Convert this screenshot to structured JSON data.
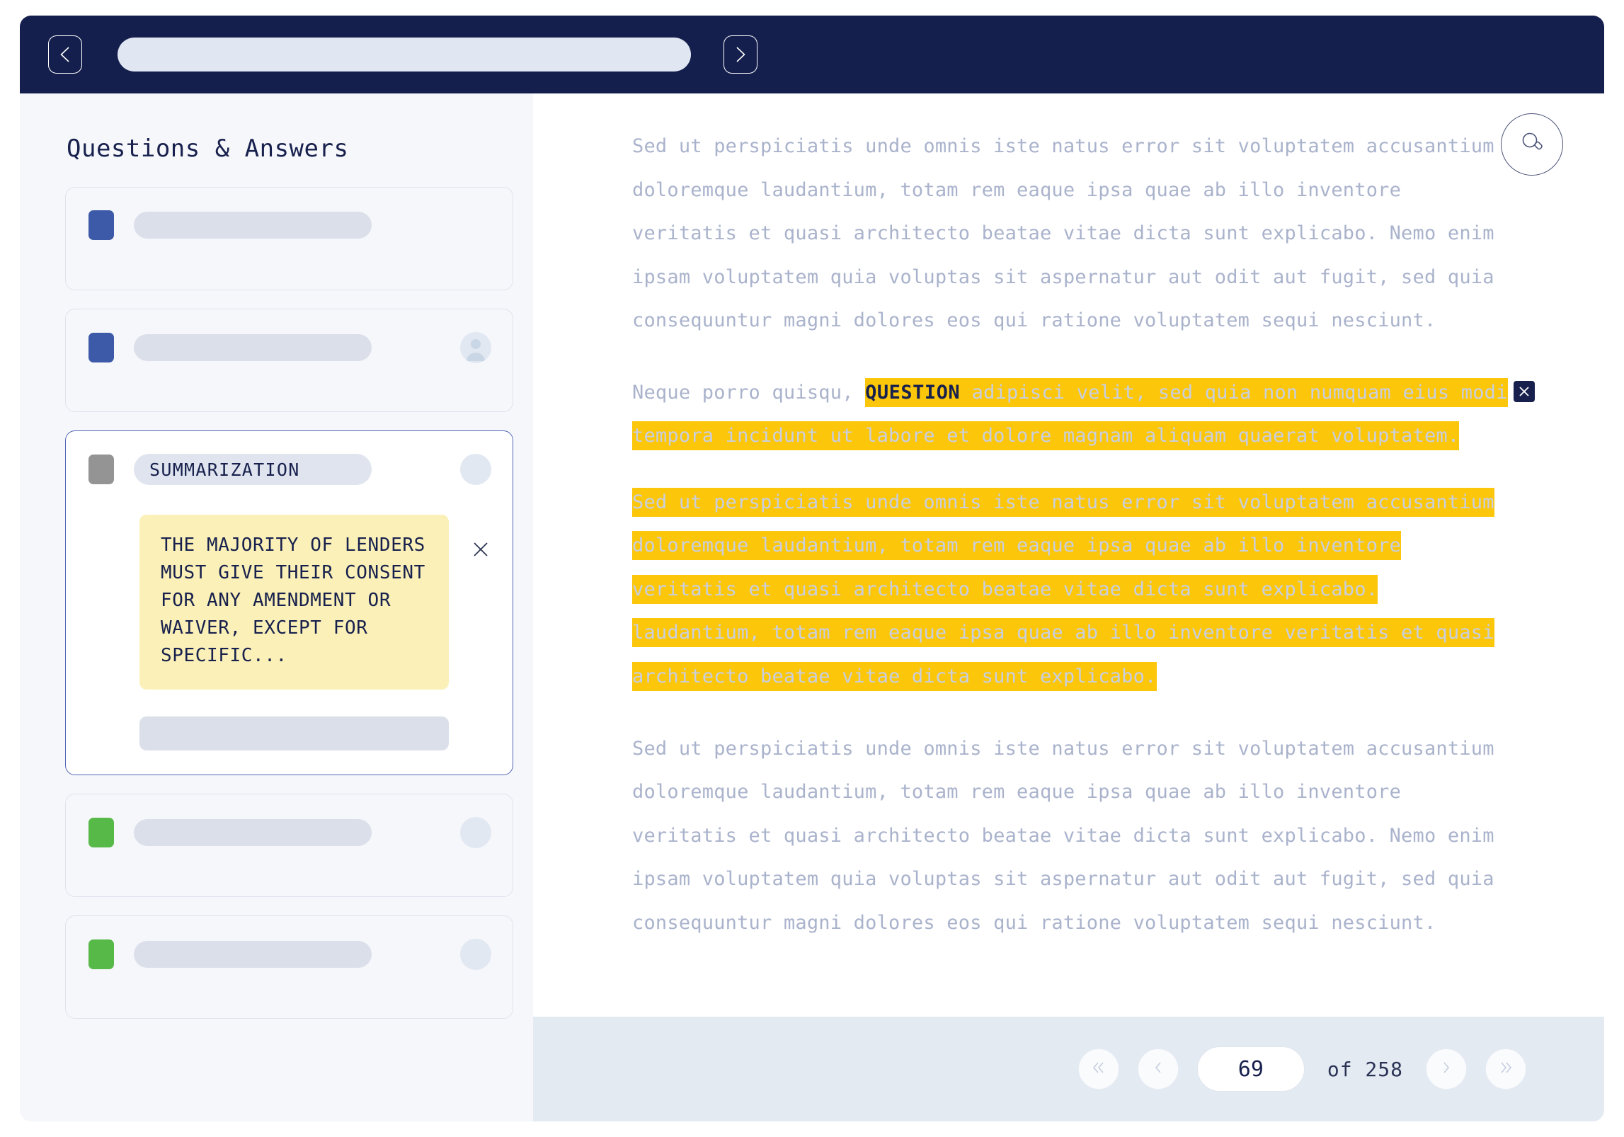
{
  "topbar": {
    "back_icon": "chevron-left-icon",
    "forward_icon": "chevron-right-icon",
    "address_value": "",
    "address_placeholder": ""
  },
  "sidebar": {
    "title": "Questions & Answers",
    "cards": [
      {
        "tag_color": "#3d5aa8",
        "label": "",
        "has_avatar": false,
        "avatar_type": "none",
        "active": false
      },
      {
        "tag_color": "#3d5aa8",
        "label": "",
        "has_avatar": true,
        "avatar_type": "person",
        "active": false
      },
      {
        "tag_color": "#949494",
        "label": "SUMMARIZATION",
        "has_avatar": true,
        "avatar_type": "plain",
        "active": true
      },
      {
        "tag_color": "#57b947",
        "label": "",
        "has_avatar": true,
        "avatar_type": "plain",
        "active": false
      },
      {
        "tag_color": "#57b947",
        "label": "",
        "has_avatar": true,
        "avatar_type": "plain",
        "active": false
      }
    ],
    "note": {
      "text": "THE MAJORITY OF LENDERS MUST GIVE THEIR CONSENT FOR ANY AMENDMENT OR WAIVER, EXCEPT FOR SPECIFIC...",
      "close_icon": "close-icon"
    }
  },
  "content": {
    "search_icon": "search-icon",
    "paragraph_1": "Sed ut perspiciatis unde omnis iste natus error sit voluptatem accusantium doloremque laudantium, totam rem eaque ipsa quae ab illo inventore veritatis et quasi architecto beatae vitae dicta sunt explicabo. Nemo enim ipsam voluptatem quia voluptas sit aspernatur aut odit aut fugit, sed quia consequuntur magni dolores eos qui ratione voluptatem sequi nesciunt.",
    "paragraph_2_lead": "Neque porro quisqu, ",
    "paragraph_2_question_word": "QUESTION",
    "paragraph_2_highlight": " adipisci velit, sed quia non numquam eius modi tempora incidunt ut labore et dolore magnam aliquam quaerat voluptatem.",
    "paragraph_2_close_icon": "close-icon",
    "paragraph_3_highlight": "Sed ut perspiciatis unde omnis iste natus error sit voluptatem accusantium doloremque laudantium, totam rem eaque ipsa quae ab illo inventore veritatis et quasi architecto beatae vitae dicta sunt explicabo. laudantium, totam rem eaque ipsa quae ab illo inventore veritatis et quasi architecto beatae vitae dicta sunt explicabo.",
    "paragraph_4": "Sed ut perspiciatis unde omnis iste natus error sit voluptatem accusantium doloremque laudantium, totam rem eaque ipsa quae ab illo inventore veritatis et quasi architecto beatae vitae dicta sunt explicabo. Nemo enim ipsam voluptatem quia voluptas sit aspernatur aut odit aut fugit, sed quia consequuntur magni dolores eos qui ratione voluptatem sequi nesciunt."
  },
  "pagination": {
    "first_icon": "double-chevron-left-icon",
    "prev_icon": "chevron-left-icon",
    "current_page": "69",
    "separator": "of  258",
    "next_icon": "chevron-right-icon",
    "last_icon": "double-chevron-right-icon"
  },
  "colors": {
    "navy": "#141f4d",
    "highlight_yellow": "#fcc60b",
    "note_yellow": "#faf0b8",
    "tag_blue": "#3d5aa8",
    "tag_green": "#57b947",
    "tag_gray": "#949494",
    "sidebar_bg": "#f6f7fb",
    "footer_bg": "#e4eaf2",
    "body_text": "#aab3cc"
  }
}
